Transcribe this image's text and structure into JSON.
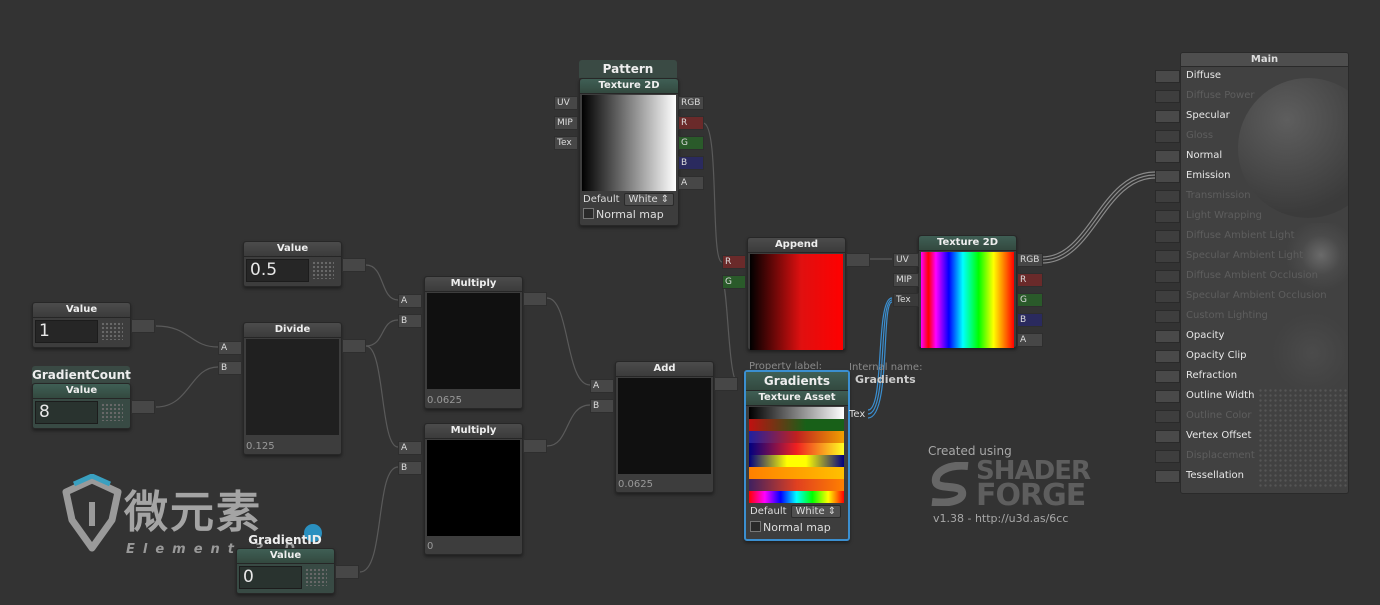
{
  "nodes": {
    "pattern": {
      "title": "Pattern",
      "subtitle": "Texture 2D",
      "inputs": [
        "UV",
        "MIP",
        "Tex"
      ],
      "outputs": [
        "RGB",
        "R",
        "G",
        "B",
        "A"
      ],
      "default_label": "Default",
      "default_value": "White",
      "normal_map_label": "Normal map"
    },
    "value_half": {
      "title": "Value",
      "value": "0.5"
    },
    "value_one": {
      "title": "Value",
      "value": "1"
    },
    "gradient_count": {
      "label": "GradientCount",
      "title": "Value",
      "value": "8"
    },
    "divide": {
      "title": "Divide",
      "inputs": [
        "A",
        "B"
      ],
      "result": "0.125"
    },
    "multiply_top": {
      "title": "Multiply",
      "inputs": [
        "A",
        "B"
      ],
      "result": "0.0625"
    },
    "multiply_bottom": {
      "title": "Multiply",
      "inputs": [
        "A",
        "B"
      ],
      "result": "0"
    },
    "add": {
      "title": "Add",
      "inputs": [
        "A",
        "B"
      ],
      "result": "0.0625"
    },
    "append": {
      "title": "Append",
      "inputs": [
        "R",
        "G"
      ]
    },
    "gradients": {
      "property_label_caption": "Property label:",
      "internal_name_caption": "Internal name:",
      "internal_name": "Gradients",
      "title": "Gradients",
      "subtitle": "Texture Asset",
      "outputs": [
        "Tex"
      ],
      "default_label": "Default",
      "default_value": "White",
      "normal_map_label": "Normal map"
    },
    "texture2d": {
      "title": "Texture 2D",
      "inputs": [
        "UV",
        "MIP",
        "Tex"
      ],
      "outputs": [
        "RGB",
        "R",
        "G",
        "B",
        "A"
      ]
    },
    "gradient_id": {
      "label": "GradientID",
      "title": "Value",
      "value": "0"
    }
  },
  "credit": {
    "created_using": "Created using",
    "logo_line1": "SHADER",
    "logo_line2": "FORGE",
    "version": "v1.38 - http://u3d.as/6cc"
  },
  "watermark": {
    "text": "微元素",
    "subtext": "Element 3 D"
  },
  "main": {
    "title": "Main",
    "inputs": [
      {
        "label": "Diffuse",
        "enabled": true
      },
      {
        "label": "Diffuse Power",
        "enabled": false
      },
      {
        "label": "Specular",
        "enabled": true
      },
      {
        "label": "Gloss",
        "enabled": false
      },
      {
        "label": "Normal",
        "enabled": true
      },
      {
        "label": "Emission",
        "enabled": true
      },
      {
        "label": "Transmission",
        "enabled": false
      },
      {
        "label": "Light Wrapping",
        "enabled": false
      },
      {
        "label": "Diffuse Ambient Light",
        "enabled": false
      },
      {
        "label": "Specular Ambient Light",
        "enabled": false
      },
      {
        "label": "Diffuse Ambient Occlusion",
        "enabled": false
      },
      {
        "label": "Specular Ambient Occlusion",
        "enabled": false
      },
      {
        "label": "Custom Lighting",
        "enabled": false
      },
      {
        "label": "Opacity",
        "enabled": true
      },
      {
        "label": "Opacity Clip",
        "enabled": true
      },
      {
        "label": "Refraction",
        "enabled": true
      },
      {
        "label": "Outline Width",
        "enabled": true
      },
      {
        "label": "Outline Color",
        "enabled": false
      },
      {
        "label": "Vertex Offset",
        "enabled": true
      },
      {
        "label": "Displacement",
        "enabled": false
      },
      {
        "label": "Tessellation",
        "enabled": true
      }
    ]
  },
  "colors": {
    "background": "#333333",
    "selection": "#3b8fd0",
    "port_red": "#6a2a2a",
    "port_green": "#2a5a2a",
    "port_blue": "#2a2a5e"
  }
}
